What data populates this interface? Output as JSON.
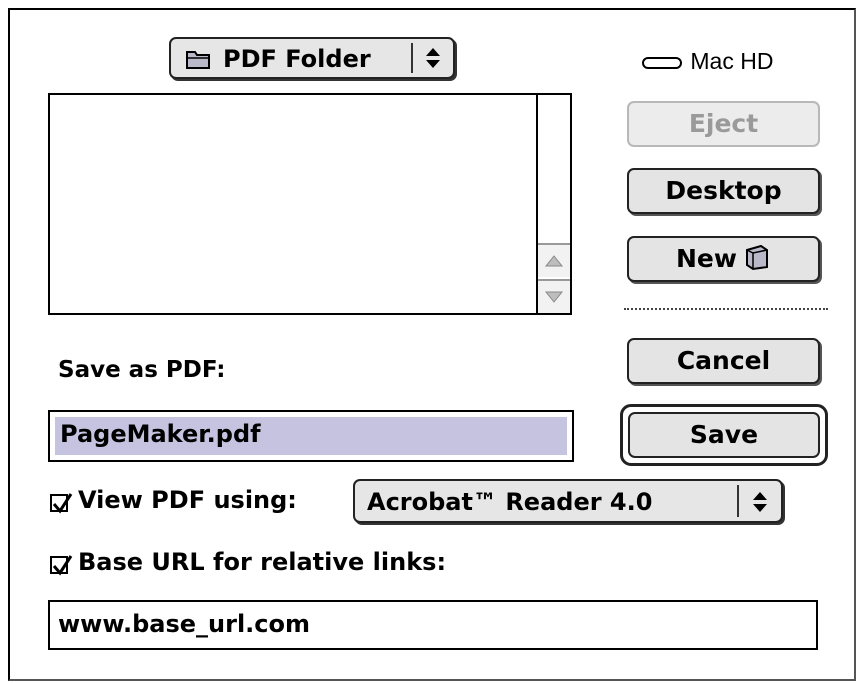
{
  "folder_popup": {
    "label": "PDF Folder",
    "icon": "folder-icon"
  },
  "drive": {
    "label": "Mac HD",
    "icon": "hard-drive-icon"
  },
  "buttons": {
    "eject": "Eject",
    "desktop": "Desktop",
    "new": "New",
    "cancel": "Cancel",
    "save": "Save"
  },
  "save_as": {
    "label": "Save as PDF:",
    "value": "PageMaker.pdf"
  },
  "view_pdf": {
    "label": "View PDF using:",
    "checked": true,
    "selected_app": "Acrobat™ Reader 4.0"
  },
  "base_url": {
    "label": "Base URL for relative links:",
    "checked": true,
    "value": "www.base_url.com"
  },
  "colors": {
    "selection": "#c6c3e1",
    "button_face": "#e4e4e4",
    "disabled_text": "#9a9a9a"
  }
}
